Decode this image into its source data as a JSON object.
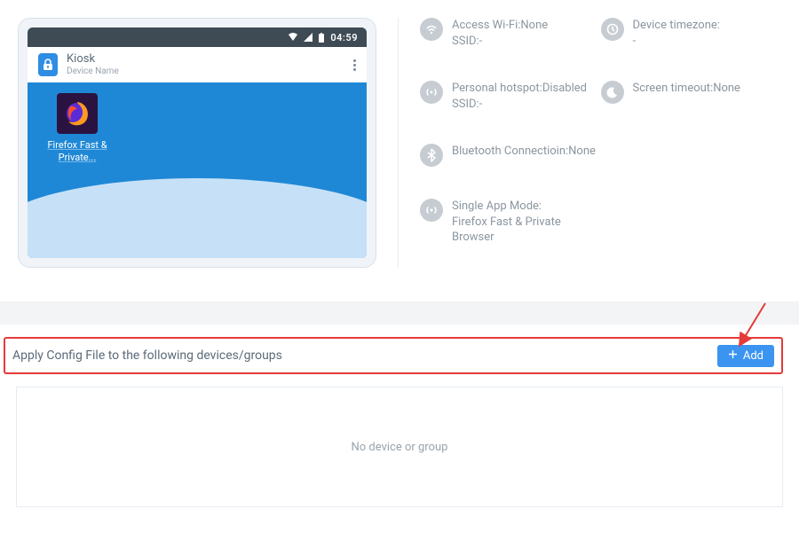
{
  "device_preview": {
    "status_time": "04:59",
    "kiosk_title": "Kiosk",
    "kiosk_subtitle": "Device Name",
    "app_label": "Firefox Fast & Private..."
  },
  "info": {
    "wifi": {
      "label": "Access Wi-Fi:None",
      "sub": "SSID:-"
    },
    "timezone": {
      "label": "Device timezone:",
      "sub": "-"
    },
    "hotspot": {
      "label": "Personal hotspot:Disabled",
      "sub": "SSID:-"
    },
    "screen_timeout": {
      "label": "Screen timeout:None"
    },
    "bluetooth": {
      "label": "Bluetooth Connectioin:None"
    },
    "single_app": {
      "label": "Single App Mode:",
      "sub": "Firefox Fast & Private Browser"
    }
  },
  "config": {
    "header_label": "Apply Config File to the following devices/groups",
    "add_button": "Add",
    "empty_text": "No device or group"
  }
}
